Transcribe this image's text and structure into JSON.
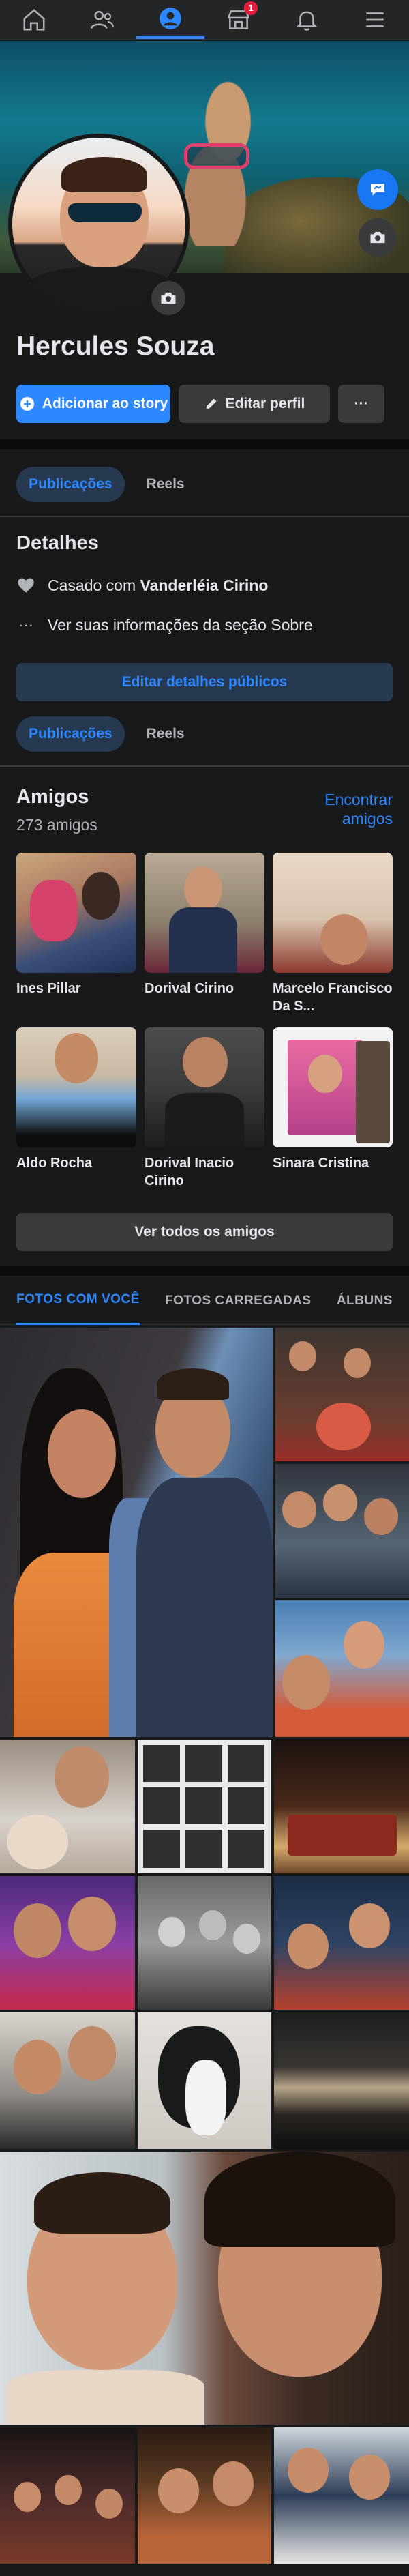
{
  "nav": {
    "items": [
      {
        "icon": "home-icon",
        "active": false
      },
      {
        "icon": "friends-icon",
        "active": false
      },
      {
        "icon": "profile-icon",
        "active": true
      },
      {
        "icon": "marketplace-icon",
        "active": false,
        "badge": "1"
      },
      {
        "icon": "notifications-icon",
        "active": false
      },
      {
        "icon": "menu-icon",
        "active": false
      }
    ],
    "marketplace_badge": "1"
  },
  "profile": {
    "name": "Hercules Souza"
  },
  "actions": {
    "add_story": "Adicionar ao story",
    "edit_profile": "Editar perfil",
    "more": "···"
  },
  "tabs_top": {
    "posts": "Publicações",
    "reels": "Reels"
  },
  "details": {
    "title": "Detalhes",
    "relationship_prefix": "Casado com ",
    "relationship_partner": "Vanderléia Cirino",
    "about_link": "Ver suas informações da seção Sobre",
    "edit_button": "Editar detalhes públicos"
  },
  "tabs_mid": {
    "posts": "Publicações",
    "reels": "Reels"
  },
  "friends": {
    "title": "Amigos",
    "count": "273 amigos",
    "find_line1": "Encontrar",
    "find_line2": "amigos",
    "list": [
      {
        "name": "Ines Pillar"
      },
      {
        "name": "Dorival Cirino"
      },
      {
        "name": "Marcelo Francisco Da S..."
      },
      {
        "name": "Aldo Rocha"
      },
      {
        "name": "Dorival Inacio Cirino"
      },
      {
        "name": "Sinara Cristina"
      }
    ],
    "see_all": "Ver todos os amigos"
  },
  "photos": {
    "tabs": [
      "FOTOS COM VOCÊ",
      "FOTOS CARREGADAS",
      "ÁLBUNS"
    ],
    "active_tab": "FOTOS COM VOCÊ"
  },
  "colors": {
    "accent": "#2d88ff",
    "background": "#18191a",
    "surface": "#242526",
    "button": "#3a3b3c",
    "badge": "#e41e3f"
  }
}
